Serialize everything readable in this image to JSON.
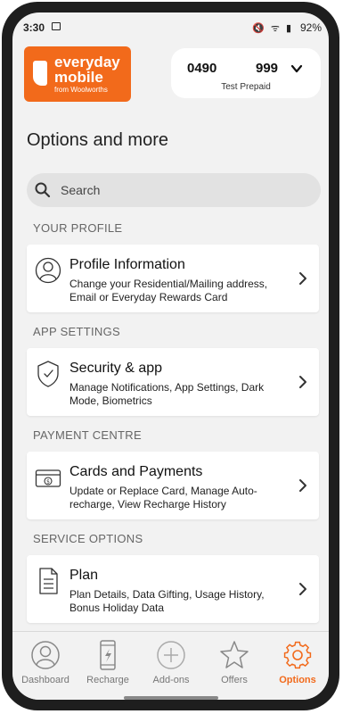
{
  "status_bar": {
    "time": "3:30",
    "icons": "🔇 ᯤ ▮",
    "battery": "92%"
  },
  "header": {
    "logo": {
      "line1": "everyday",
      "line2": "mobile",
      "line3": "from Woolworths"
    },
    "account": {
      "number_start": "0490",
      "number_end": "999",
      "plan_label": "Test Prepaid"
    }
  },
  "page_title": "Options and more",
  "search": {
    "placeholder": "Search"
  },
  "sections": [
    {
      "heading": "YOUR PROFILE",
      "title": "Profile Information",
      "description": "Change your Residential/Mailing address, Email or Everyday Rewards Card",
      "icon": "profile-icon"
    },
    {
      "heading": "APP SETTINGS",
      "title": "Security & app",
      "description": "Manage Notifications, App Settings, Dark Mode, Biometrics",
      "icon": "shield-icon"
    },
    {
      "heading": "PAYMENT CENTRE",
      "title": "Cards and Payments",
      "description": "Update or Replace Card, Manage Auto-recharge, View Recharge History",
      "icon": "card-icon"
    },
    {
      "heading": "SERVICE OPTIONS",
      "title": "Plan",
      "description": "Plan Details, Data Gifting, Usage History, Bonus Holiday Data",
      "icon": "document-icon"
    }
  ],
  "nav": {
    "items": [
      {
        "label": "Dashboard",
        "icon": "user-circle-icon"
      },
      {
        "label": "Recharge",
        "icon": "phone-recharge-icon"
      },
      {
        "label": "Add-ons",
        "icon": "plus-circle-icon"
      },
      {
        "label": "Offers",
        "icon": "star-icon"
      },
      {
        "label": "Options",
        "icon": "gear-icon",
        "active": true
      }
    ]
  },
  "colors": {
    "brand": "#f26a1b",
    "background": "#f2f2f2"
  }
}
